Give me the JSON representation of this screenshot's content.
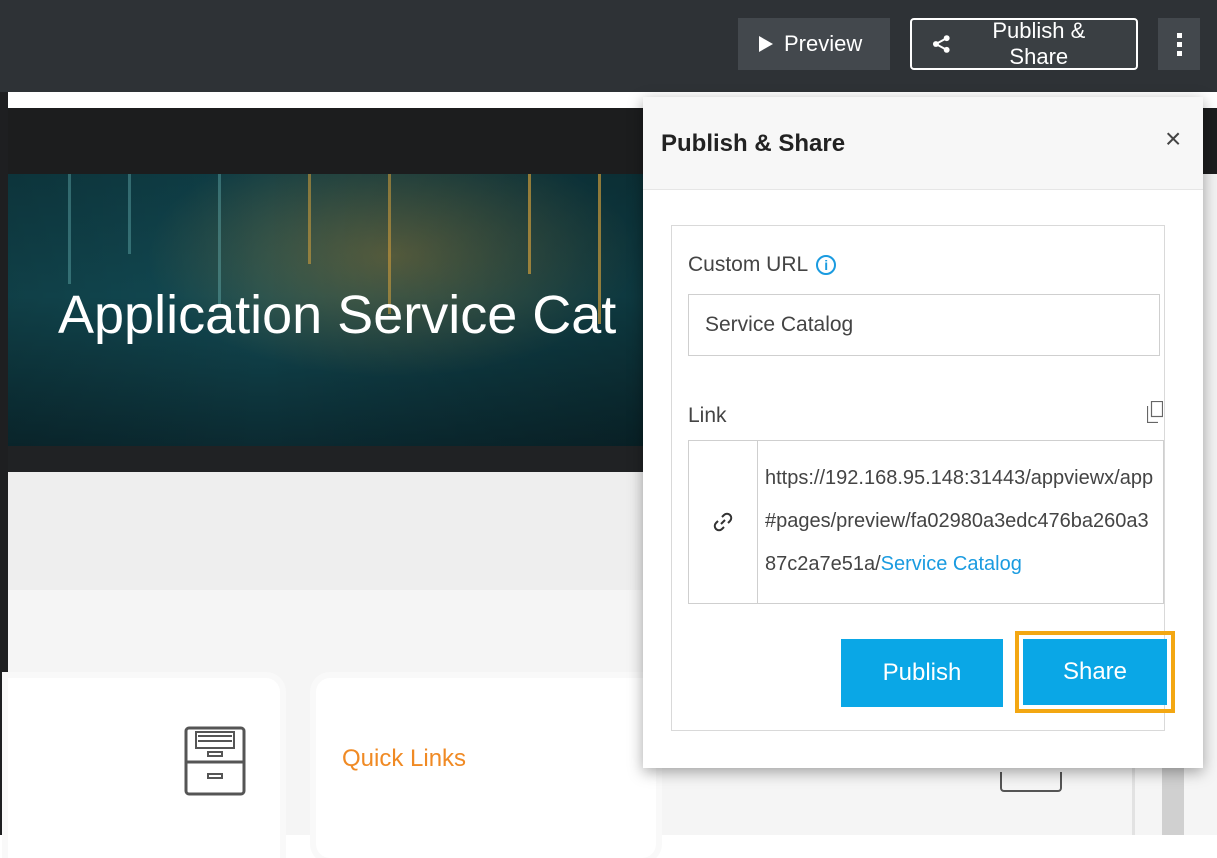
{
  "toolbar": {
    "preview_label": "Preview",
    "publish_share_label": "Publish & Share"
  },
  "banner": {
    "title": "Application Service Cat"
  },
  "cards": {
    "quick_links_title": "Quick Links"
  },
  "popover": {
    "title": "Publish & Share",
    "close_glyph": "×",
    "custom_url_label": "Custom URL",
    "info_glyph": "i",
    "custom_url_value": "Service Catalog",
    "link_label": "Link",
    "link_prefix": "https://192.168.95.148:31443/appviewx/app#pages/preview/fa02980a3edc476ba260a387c2a7e51a/",
    "link_highlight": "Service Catalog",
    "publish_label": "Publish",
    "share_label": "Share"
  },
  "colors": {
    "accent": "#0aa7e6",
    "highlight_border": "#f3a712",
    "quick_links": "#f08a24",
    "toolbar_bg": "#2e3236"
  },
  "icons": [
    "play-icon",
    "share-icon",
    "kebab-icon",
    "close-icon",
    "info-icon",
    "copy-icon",
    "link-icon",
    "file-cabinet-icon"
  ]
}
